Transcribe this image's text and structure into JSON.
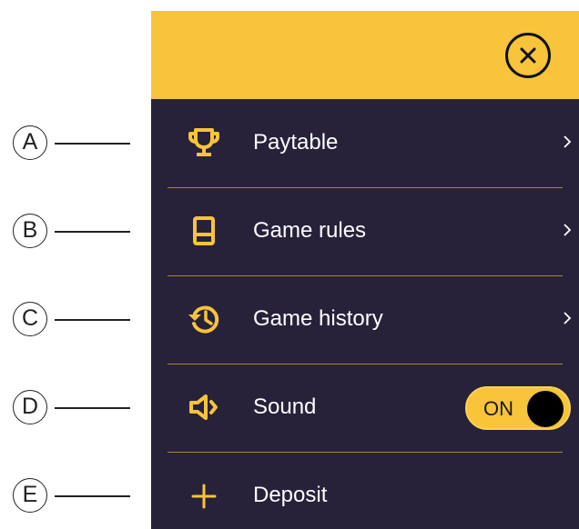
{
  "menu": {
    "items": [
      {
        "label": "Paytable",
        "icon": "trophy-icon",
        "chevron": "chevron-right-icon"
      },
      {
        "label": "Game rules",
        "icon": "book-icon",
        "chevron": "chevron-right-icon"
      },
      {
        "label": "Game history",
        "icon": "history-icon",
        "chevron": "chevron-right-icon"
      },
      {
        "label": "Sound",
        "icon": "speaker-icon",
        "toggle": {
          "text": "ON",
          "state": true
        }
      },
      {
        "label": "Deposit",
        "icon": "plus-icon"
      }
    ]
  },
  "header": {
    "close_icon": "close-icon"
  },
  "callouts": [
    "A",
    "B",
    "C",
    "D",
    "E"
  ],
  "colors": {
    "accent": "#f7c43a",
    "panel_bg": "#27213a",
    "text": "#ffffff",
    "divider": "#a3873a"
  }
}
